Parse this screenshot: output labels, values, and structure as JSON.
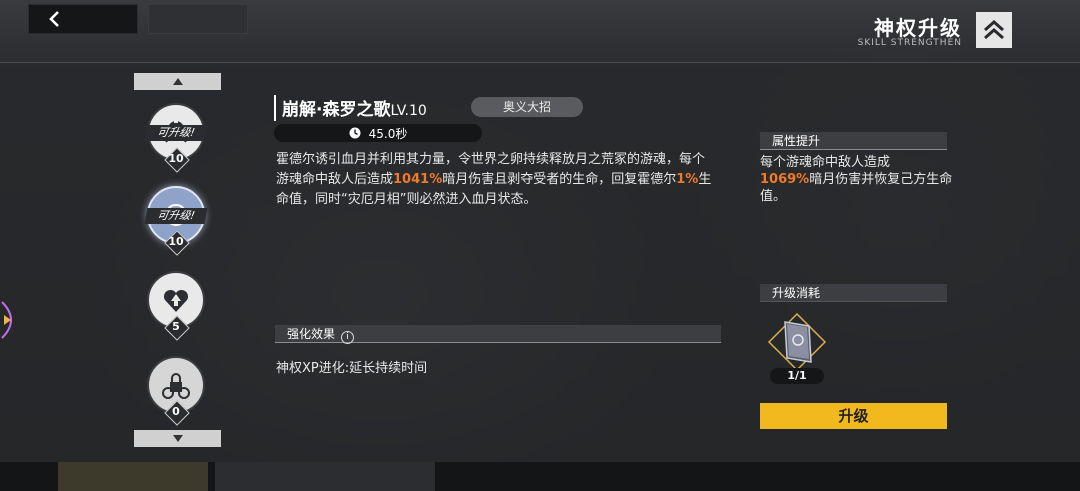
{
  "header": {
    "title_cn": "神权升级",
    "title_en": "SKILL STRENGTHEN"
  },
  "skill_list": {
    "slots": [
      {
        "level": "10",
        "upgradable_label": "可升级!",
        "icon": "goddess-crest-icon",
        "active": false
      },
      {
        "level": "10",
        "upgradable_label": "可升级!",
        "icon": "moon-blossom-icon",
        "active": true
      },
      {
        "level": "5",
        "upgradable_label": "",
        "icon": "heart-up-icon",
        "active": false
      },
      {
        "level": "0",
        "upgradable_label": "",
        "icon": "locked-skill-icon",
        "active": false
      }
    ]
  },
  "skill": {
    "name": "崩解·森罗之歌",
    "level": "LV.10",
    "type": "奥义大招",
    "cooldown": "45.0秒",
    "desc_parts": [
      {
        "text": "霍德尔诱引血月并利用其力量，令世界之卵持续释放月之荒冢的游魂，每个游魂命中敌人后造成",
        "hl": false
      },
      {
        "text": "1041%",
        "hl": true
      },
      {
        "text": "暗月伤害且剥夺受者的生命，回复霍德尔",
        "hl": false
      },
      {
        "text": "1%",
        "hl": true
      },
      {
        "text": "生命值，同时“灾厄月相”则必然进入血月状态。",
        "hl": false
      }
    ]
  },
  "enhance": {
    "section_label": "强化效果",
    "info_glyph": "i",
    "effect_text": "神权XP进化:延长持续时间"
  },
  "attribute": {
    "section_label": "属性提升",
    "text_before": "每个游魂命中敌人造成",
    "highlight": "1069%",
    "text_after": "暗月伤害并恢复己方生命值。"
  },
  "cost": {
    "section_label": "升级消耗",
    "item_icon": "skill-book-icon",
    "item_count": "1/1",
    "upgrade_label": "升级"
  },
  "colors": {
    "highlight": "#f07a2a",
    "button": "#f1b91e"
  }
}
